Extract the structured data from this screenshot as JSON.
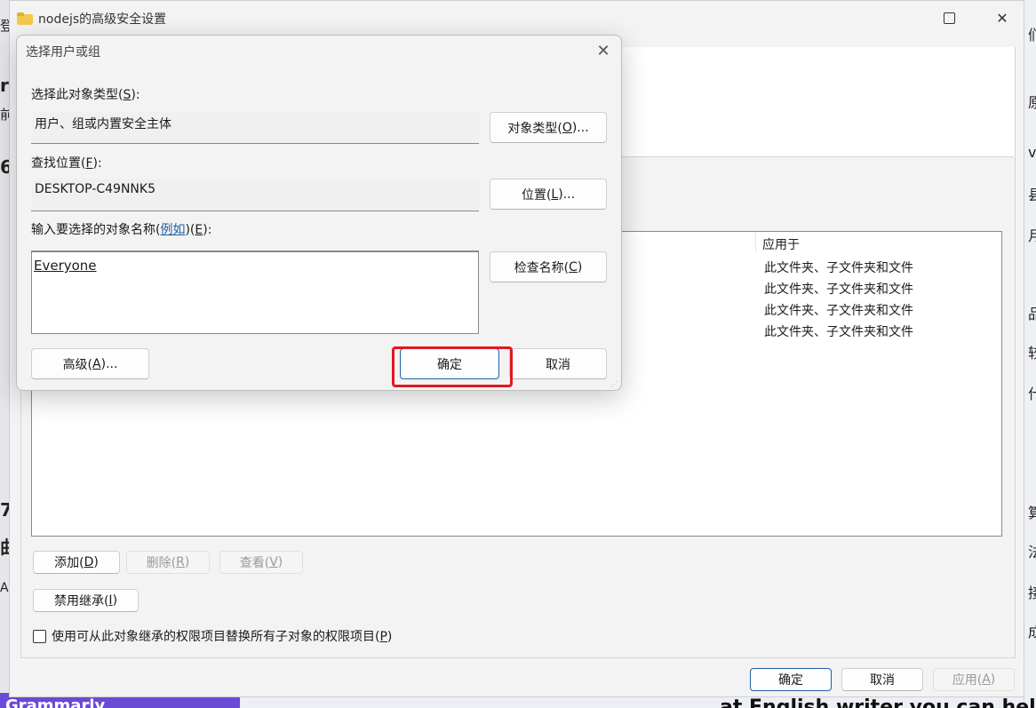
{
  "background": {
    "left_glyphs": [
      "登",
      "r",
      "前",
      "6",
      "7",
      "曲",
      "Ac"
    ],
    "right_glyphs": [
      "们",
      "原",
      "vi",
      "县",
      "月",
      "品",
      "较",
      "什",
      "算",
      "法",
      "接",
      "成"
    ],
    "bottom_left_text": "Grammarly",
    "bottom_right_text": "at English writer you can hel"
  },
  "window": {
    "title": "nodejs的高级安全设置",
    "controls": {
      "minimize": "—",
      "close": "✕"
    },
    "table": {
      "column_applies_to": "应用于",
      "rows": [
        "此文件夹、子文件夹和文件",
        "此文件夹、子文件夹和文件",
        "此文件夹、子文件夹和文件",
        "此文件夹、子文件夹和文件"
      ]
    },
    "add_label": "添加(",
    "add_key": "D",
    "delete_label": "删除(",
    "delete_key": "R",
    "view_label": "查看(",
    "view_key": "V",
    "close_paren": ")",
    "disable_inherit_label": "禁用继承(",
    "disable_inherit_key": "I",
    "replace_checkbox_label": "使用可从此对象继承的权限项目替换所有子对象的权限项目(",
    "replace_checkbox_key": "P",
    "ok_label": "确定",
    "cancel_label": "取消",
    "apply_label": "应用(",
    "apply_key": "A"
  },
  "dialog": {
    "title": "选择用户或组",
    "close_glyph": "✕",
    "object_type_label": "选择此对象类型(",
    "object_type_key": "S",
    "object_type_suffix": "):",
    "object_type_value": "用户、组或内置安全主体",
    "object_types_button": "对象类型(",
    "object_types_key": "O",
    "object_types_suffix": ")...",
    "location_label": "查找位置(",
    "location_key": "F",
    "location_suffix": "):",
    "location_value": "DESKTOP-C49NNK5",
    "location_button": "位置(",
    "location_button_key": "L",
    "location_button_suffix": ")...",
    "names_label_prefix": "输入要选择的对象名称(",
    "names_label_link": "例如",
    "names_label_mid": ")(",
    "names_label_key": "E",
    "names_label_suffix": "):",
    "names_value": "Everyone",
    "check_names_button": "检查名称(",
    "check_names_key": "C",
    "check_names_suffix": ")",
    "advanced_button": "高级(",
    "advanced_key": "A",
    "advanced_suffix": ")...",
    "ok_button": "确定",
    "cancel_button": "取消"
  },
  "colors": {
    "highlight": "#e0191f",
    "link": "#1f5fa8",
    "accent_border": "#1f5fa8"
  }
}
